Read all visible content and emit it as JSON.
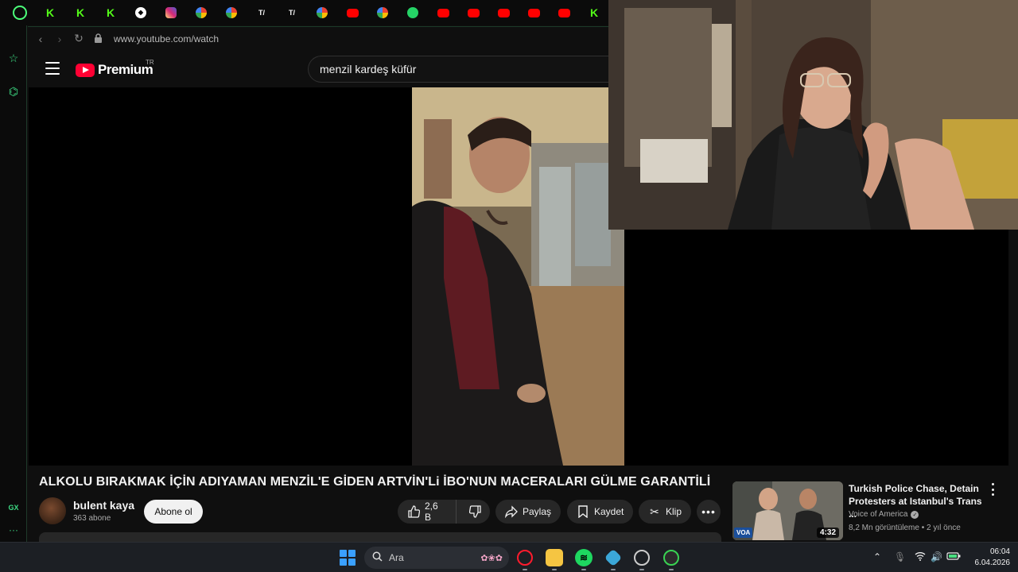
{
  "browser": {
    "tabs": [
      {
        "icon": "opera-icon",
        "glyph": ""
      },
      {
        "icon": "kick-icon",
        "glyph": "K"
      },
      {
        "icon": "kick-icon",
        "glyph": "K"
      },
      {
        "icon": "kick-icon",
        "glyph": "K"
      },
      {
        "icon": "streamer-icon",
        "glyph": "◆"
      },
      {
        "icon": "instagram-icon",
        "glyph": ""
      },
      {
        "icon": "google-icon",
        "glyph": ""
      },
      {
        "icon": "google-icon",
        "glyph": ""
      },
      {
        "icon": "tiktok-icon",
        "glyph": "T/"
      },
      {
        "icon": "tiktok-icon",
        "glyph": "T/"
      },
      {
        "icon": "google-icon",
        "glyph": ""
      },
      {
        "icon": "youtube-icon",
        "glyph": ""
      },
      {
        "icon": "google-icon",
        "glyph": ""
      },
      {
        "icon": "whatsapp-icon",
        "glyph": ""
      },
      {
        "icon": "youtube-icon",
        "glyph": ""
      },
      {
        "icon": "youtube-icon",
        "glyph": ""
      },
      {
        "icon": "youtube-icon",
        "glyph": ""
      },
      {
        "icon": "youtube-icon",
        "glyph": ""
      },
      {
        "icon": "youtube-icon",
        "glyph": ""
      },
      {
        "icon": "kick-icon",
        "glyph": "K"
      }
    ],
    "url": "www.youtube.com/watch",
    "sidebar_bottom_label": "GX",
    "accent_color": "#3ddc84"
  },
  "youtube": {
    "brand": "Premium",
    "region": "TR",
    "search_query": "menzil kardeş küfür",
    "video": {
      "title": "ALKOLU BIRAKMAK İÇİN ADIYAMAN MENZİL'E GİDEN ARTVİN'Li İBO'NUN MACERALARI GÜLME GARANTİLİ",
      "channel": "bulent kaya",
      "subscribers": "363 abone",
      "subscribe_label": "Abone ol",
      "likes": "2,6 B",
      "share_label": "Paylaş",
      "save_label": "Kaydet",
      "clip_label": "Klip"
    },
    "recommendation": {
      "title": "Turkish Police Chase, Detain Protesters at Istanbul's Trans ...",
      "channel": "Voice of America",
      "views": "8,2 Mn görüntüleme",
      "age": "2 yıl önce",
      "duration": "4:32",
      "badge": "VOA"
    }
  },
  "taskbar": {
    "search_placeholder": "Ara",
    "time": "06:04",
    "date": "6.04.2026"
  }
}
